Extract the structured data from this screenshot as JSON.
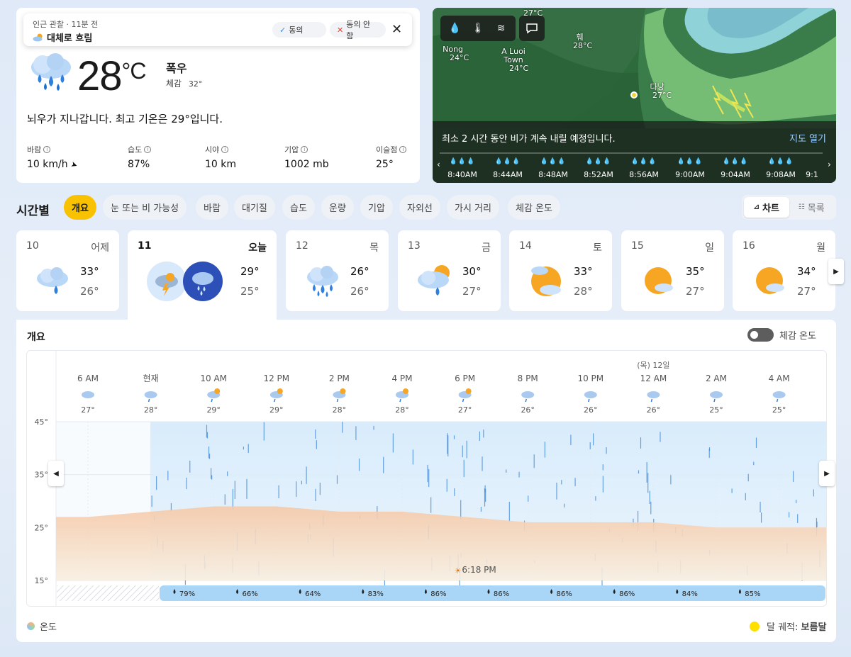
{
  "observation": {
    "label": "인근 관찰 · 11분 전",
    "condition": "대체로 흐림",
    "agree": "동의",
    "disagree": "동의 안 함"
  },
  "current": {
    "temp": "28",
    "unit": "°C",
    "condition": "폭우",
    "feels_label": "체감",
    "feels_value": "32°",
    "summary": "뇌우가 지나갑니다. 최고 기온은 29°입니다.",
    "stats": [
      {
        "label": "바람",
        "value": "10 km/h"
      },
      {
        "label": "습도",
        "value": "87%"
      },
      {
        "label": "시야",
        "value": "10 km"
      },
      {
        "label": "기압",
        "value": "1002 mb"
      },
      {
        "label": "이슬점",
        "value": "25°"
      }
    ]
  },
  "map": {
    "places": [
      {
        "name": "27°C",
        "sub": ""
      },
      {
        "name": "Nong",
        "sub": "24°C"
      },
      {
        "name": "A Luoi Town",
        "sub": "24°C"
      },
      {
        "name": "훼",
        "sub": "28°C"
      },
      {
        "name": "다낭",
        "sub": "27°C"
      }
    ],
    "message": "최소 2 시간 동안 비가 계속 내릴 예정입니다.",
    "open_link": "지도 열기",
    "times": [
      "8:40AM",
      "8:44AM",
      "8:48AM",
      "8:52AM",
      "8:56AM",
      "9:00AM",
      "9:04AM",
      "9:08AM",
      "9:1"
    ]
  },
  "hourly": {
    "title": "시간별",
    "tabs": [
      "개요",
      "눈 또는 비 가능성",
      "바람",
      "대기질",
      "습도",
      "운량",
      "기압",
      "자외선",
      "가시 거리",
      "체감 온도"
    ],
    "view_chart": "차트",
    "view_list": "목록"
  },
  "days": [
    {
      "date": "10",
      "name": "어제",
      "hi": "33°",
      "lo": "26°",
      "icon": "rain-cloud-icon"
    },
    {
      "date": "11",
      "name": "오늘",
      "hi": "29°",
      "lo": "25°",
      "icon": "thunder-rain-icon"
    },
    {
      "date": "12",
      "name": "목",
      "hi": "26°",
      "lo": "26°",
      "icon": "heavy-rain-icon"
    },
    {
      "date": "13",
      "name": "금",
      "hi": "30°",
      "lo": "27°",
      "icon": "sun-rain-icon"
    },
    {
      "date": "14",
      "name": "토",
      "hi": "33°",
      "lo": "28°",
      "icon": "sun-cloud-icon"
    },
    {
      "date": "15",
      "name": "일",
      "hi": "35°",
      "lo": "27°",
      "icon": "sun-cloud-icon"
    },
    {
      "date": "16",
      "name": "월",
      "hi": "34°",
      "lo": "27°",
      "icon": "sun-cloud-icon"
    }
  ],
  "overview": {
    "title": "개요",
    "feels_toggle": "체감 온도",
    "legend_temp": "온도",
    "moon_label": "달 궤적:",
    "moon_value": "보름달"
  },
  "chart_data": {
    "type": "area",
    "x": [
      "6 AM",
      "현재",
      "10 AM",
      "12 PM",
      "2 PM",
      "4 PM",
      "6 PM",
      "8 PM",
      "10 PM",
      "12 AM",
      "2 AM",
      "4 AM"
    ],
    "y": [
      27,
      28,
      29,
      29,
      28,
      28,
      27,
      26,
      26,
      26,
      25,
      25
    ],
    "temp_labels": [
      "27°",
      "28°",
      "29°",
      "29°",
      "28°",
      "28°",
      "27°",
      "26°",
      "26°",
      "26°",
      "25°",
      "25°"
    ],
    "day_marker": "(목) 12일",
    "y_ticks": [
      "45°",
      "35°",
      "25°",
      "15°"
    ],
    "ylim": [
      15,
      45
    ],
    "sunset_label": "6:18 PM",
    "precip": [
      "79%",
      "66%",
      "64%",
      "83%",
      "86%",
      "86%",
      "86%",
      "86%",
      "84%",
      "85%"
    ]
  }
}
